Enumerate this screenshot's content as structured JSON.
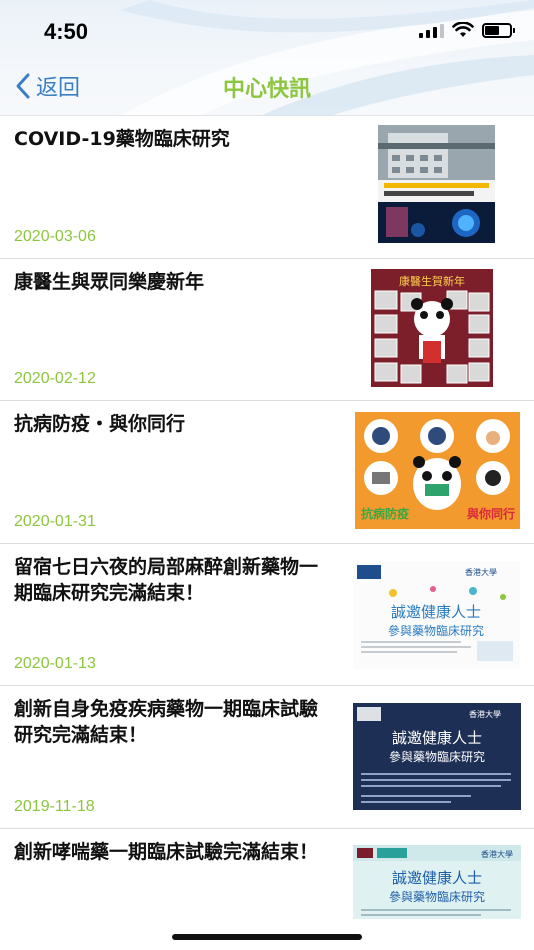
{
  "status_bar": {
    "time": "4:50"
  },
  "nav": {
    "back_label": "返回",
    "title": "中心快訊"
  },
  "colors": {
    "accent_green": "#8cc63f",
    "back_blue": "#3a7fc4"
  },
  "news": [
    {
      "title": "COVID-19藥物臨床研究",
      "date": "2020-03-06",
      "thumb": "hospital-virus-poster"
    },
    {
      "title": "康醫生與眾同樂慶新年",
      "date": "2020-02-12",
      "thumb": "new-year-panda-collage"
    },
    {
      "title": "抗病防疫・與你同行",
      "date": "2020-01-31",
      "thumb": "epidemic-prevention-poster"
    },
    {
      "title": "留宿七日六夜的局部麻醉創新藥物一期臨床研究完滿結束！",
      "date": "2020-01-13",
      "thumb": "recruitment-poster-light"
    },
    {
      "title": "創新自身免疫疾病藥物一期臨床試驗研究完滿結束！",
      "date": "2019-11-18",
      "thumb": "recruitment-poster-dark"
    },
    {
      "title": "創新哮喘藥一期臨床試驗完滿結束！",
      "date": "",
      "thumb": "recruitment-poster-teal"
    }
  ],
  "thumbnail_text": {
    "poster_headline": "誠邀健康人士",
    "poster_subline": "參與藥物臨床研究",
    "hku_label": "香港大學",
    "panda_banner": "康醫生賀新年",
    "fight_text": "抗病防疫",
    "with_you_text": "與你同行"
  }
}
